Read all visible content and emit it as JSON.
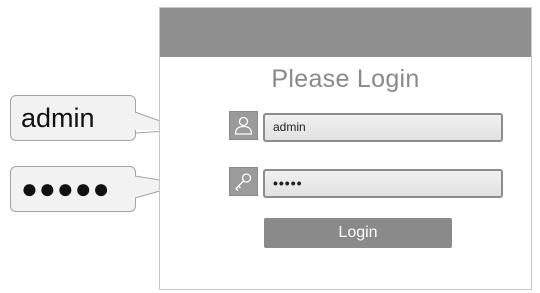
{
  "login_panel": {
    "title": "Please Login",
    "username": {
      "value": "admin",
      "icon": "user-icon"
    },
    "password": {
      "value": "•••••",
      "icon": "key-icon"
    },
    "login_label": "Login"
  },
  "callouts": {
    "username_text": "admin",
    "password_text": "●●●●●"
  },
  "colors": {
    "header": "#8f8f8f",
    "button": "#8a8a8a",
    "title": "#8a8a8a"
  }
}
